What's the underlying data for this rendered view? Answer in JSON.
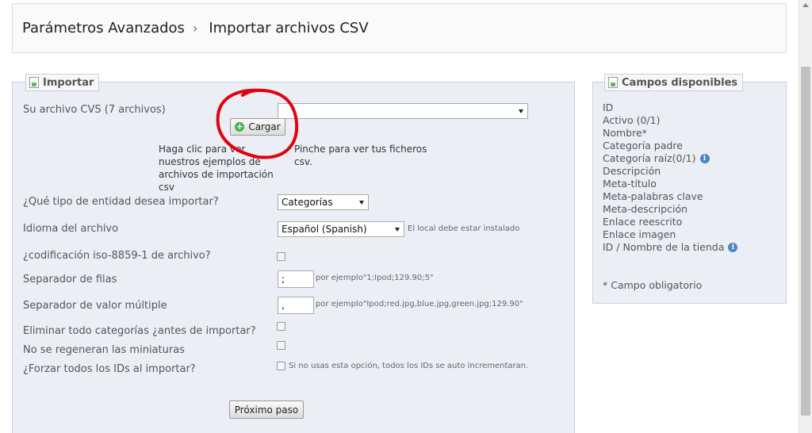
{
  "breadcrumb": {
    "parent": "Parámetros Avanzados",
    "separator": "›",
    "current": "Importar archivos CSV"
  },
  "import_panel": {
    "title": "Importar",
    "file_label": "Su archivo CVS (7 archivos)",
    "file_select_value": "",
    "upload_button": "Cargar",
    "help_examples": "Haga clic para ver nuestros ejemplos de archivos de importación csv",
    "help_files": "Pinche para ver tus ficheros csv.",
    "entity_label": "¿Qué tipo de entidad desea importar?",
    "entity_value": "Categorías",
    "language_label": "Idioma del archivo",
    "language_value": "Español (Spanish)",
    "language_hint": "El local debe estar instalado",
    "encoding_label": "¿codificación iso-8859-1 de archivo?",
    "row_sep_label": "Separador de filas",
    "row_sep_value": ";",
    "row_sep_hint": "por ejemplo\"1;Ipod;129.90;5\"",
    "multi_sep_label": "Separador de valor múltiple",
    "multi_sep_value": ",",
    "multi_sep_hint": "por ejemplo\"Ipod;red.jpg,blue.jpg,green.jpg;129.90\"",
    "delete_label": "Eliminar todo categorías ¿antes de importar?",
    "no_thumbs_label": "No se regeneran las miniaturas",
    "force_ids_label": "¿Forzar todos los IDs al importar?",
    "force_ids_hint": "Si no usas esta opción, todos los IDs se auto incrementaran.",
    "next_button": "Próximo paso"
  },
  "fields_panel": {
    "title": "Campos disponibles",
    "fields": [
      {
        "label": "ID",
        "info": false
      },
      {
        "label": "Activo (0/1)",
        "info": false
      },
      {
        "label": "Nombre*",
        "info": false
      },
      {
        "label": "Categoría padre",
        "info": false
      },
      {
        "label": "Categoría raíz(0/1)",
        "info": true
      },
      {
        "label": "Descripción",
        "info": false
      },
      {
        "label": "Meta-título",
        "info": false
      },
      {
        "label": "Meta-palabras clave",
        "info": false
      },
      {
        "label": "Meta-descripción",
        "info": false
      },
      {
        "label": "Enlace reescrito",
        "info": false
      },
      {
        "label": "Enlace imagen",
        "info": false
      },
      {
        "label": "ID / Nombre de la tienda",
        "info": true
      }
    ],
    "required_note": "* Campo obligatorio"
  },
  "icons": {
    "legend": "document-icon",
    "upload": "plus-icon",
    "info": "info-icon"
  },
  "colors": {
    "panel_bg": "#ebeef5",
    "annotation": "#e3000f",
    "info": "#4a86c5",
    "upload": "#4cae4c"
  }
}
